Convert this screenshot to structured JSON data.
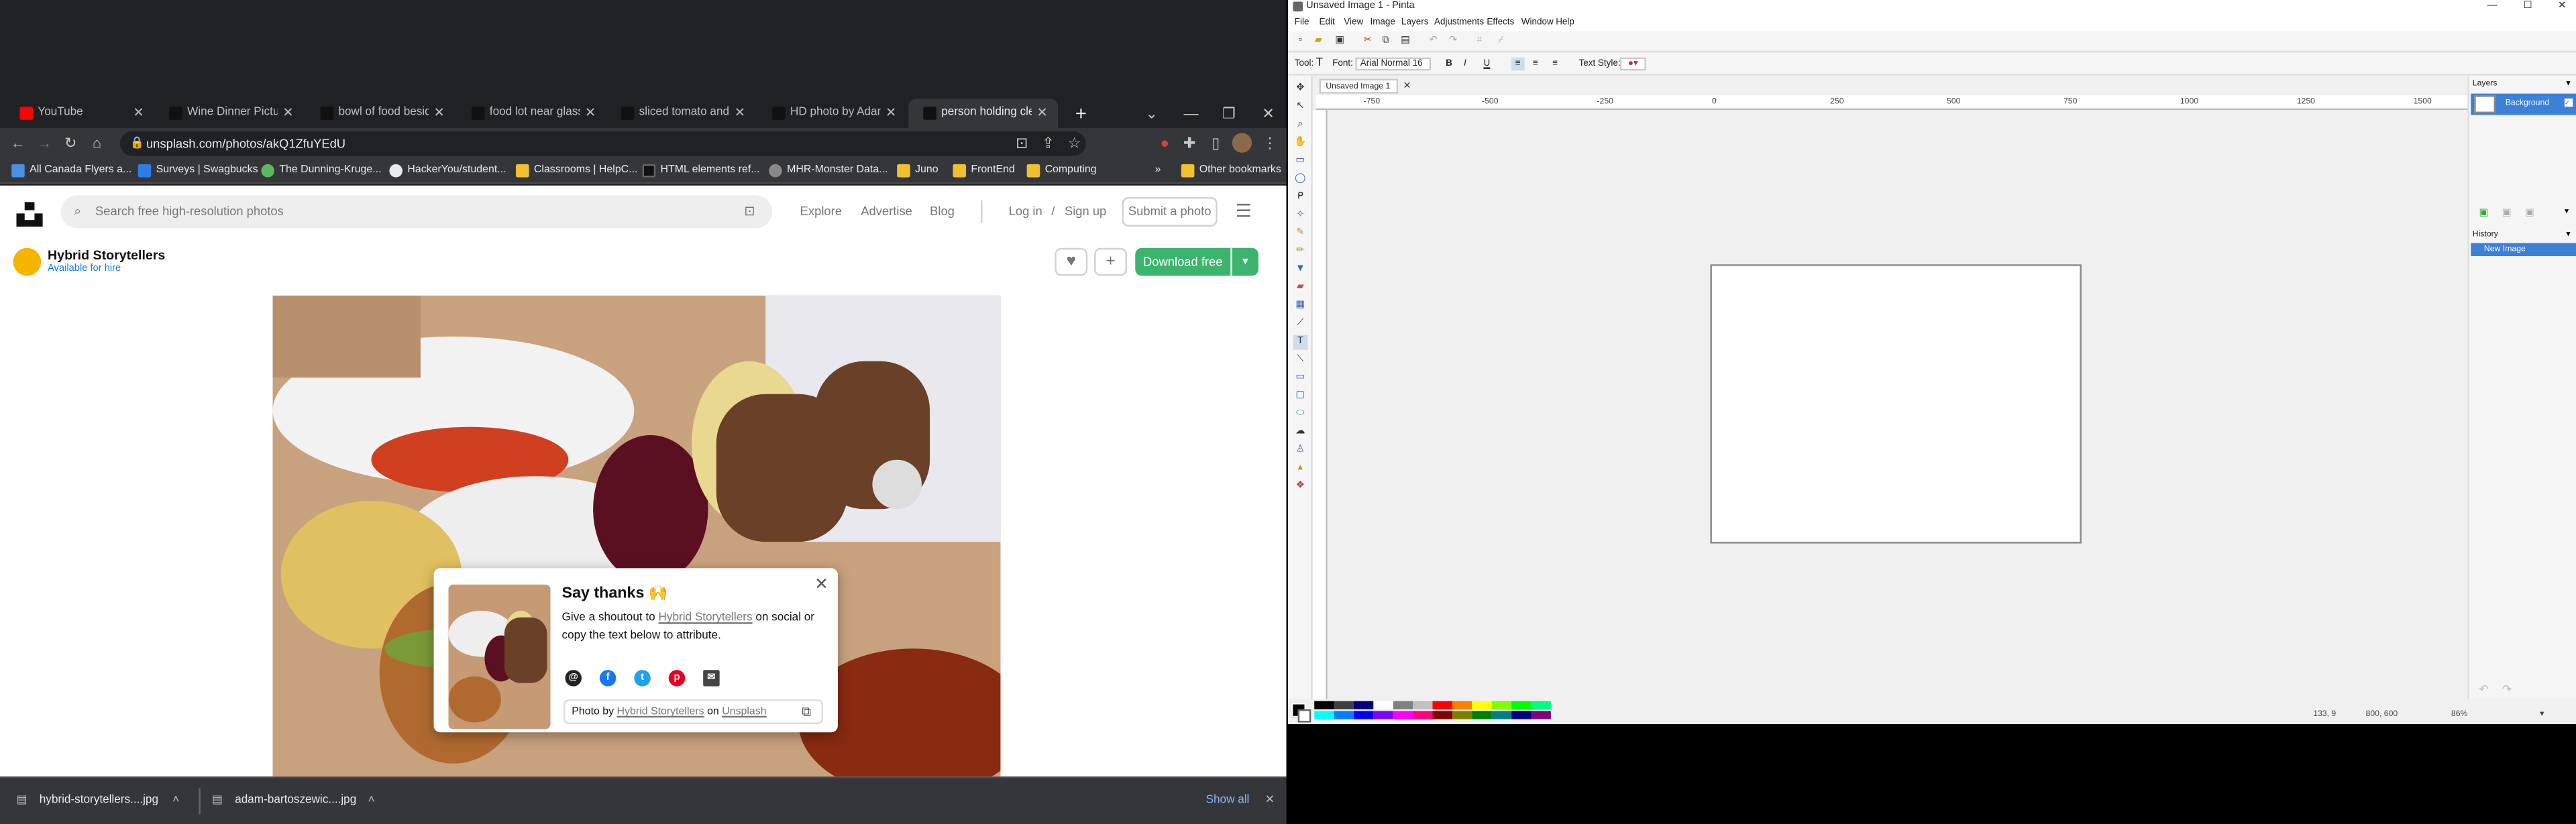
{
  "browser": {
    "tabs": [
      {
        "label": "YouTube",
        "color": "#ff0000"
      },
      {
        "label": "Wine Dinner Pictures",
        "color": "#111111"
      },
      {
        "label": "bowl of food beside",
        "color": "#111111"
      },
      {
        "label": "food lot near glasses",
        "color": "#111111"
      },
      {
        "label": "sliced tomato and cu",
        "color": "#111111"
      },
      {
        "label": "HD photo by Adam B",
        "color": "#111111"
      },
      {
        "label": "person holding clear",
        "color": "#111111"
      }
    ],
    "new_tab_label": "+",
    "url": "unsplash.com/photos/akQ1ZfuYEdU",
    "bookmarks": [
      {
        "label": "All Canada Flyers a...",
        "color": "#4a90e2"
      },
      {
        "label": "Surveys | Swagbucks",
        "color": "#2b7de9"
      },
      {
        "label": "The Dunning-Kruge...",
        "color": "#5cb85c"
      },
      {
        "label": "HackerYou/student...",
        "color": "#e8eaed"
      },
      {
        "label": "Classrooms | HelpC...",
        "color": "#f0c030"
      },
      {
        "label": "HTML elements ref...",
        "color": "#111111"
      },
      {
        "label": "MHR-Monster Data...",
        "color": "#888888"
      },
      {
        "label": "Juno",
        "color": "#f0c030"
      },
      {
        "label": "FrontEnd",
        "color": "#f0c030"
      },
      {
        "label": "Computing",
        "color": "#f0c030"
      }
    ],
    "bookmarks_more": "»",
    "other_bookmarks": "Other bookmarks",
    "downloads": [
      {
        "label": "hybrid-storytellers....jpg"
      },
      {
        "label": "adam-bartoszewic....jpg"
      }
    ],
    "show_all": "Show all"
  },
  "unsplash": {
    "search_placeholder": "Search free high-resolution photos",
    "nav": [
      "Explore",
      "Advertise",
      "Blog"
    ],
    "login": "Log in",
    "slash": "/",
    "signup": "Sign up",
    "submit": "Submit a photo",
    "author_name": "Hybrid Storytellers",
    "author_status": "Available for hire",
    "download": "Download free",
    "popup": {
      "title": "Say thanks 🙌",
      "body_pre": "Give a shoutout to",
      "body_link": "Hybrid Storytellers",
      "body_post": "on social or copy the text below to attribute.",
      "credit_pre": "Photo by",
      "credit_author": "Hybrid Storytellers",
      "credit_mid": "on",
      "credit_site": "Unsplash"
    }
  },
  "pinta": {
    "title": "Unsaved Image 1 - Pinta",
    "menu": [
      "File",
      "Edit",
      "View",
      "Image",
      "Layers",
      "Adjustments",
      "Effects",
      "Window",
      "Help"
    ],
    "tool_label": "Tool:",
    "font_label": "Font:",
    "font_value": "Arial Normal",
    "font_size": "16",
    "text_style_label": "Text Style:",
    "doc_tab": "Unsaved Image 1",
    "ruler_labels": [
      "-750",
      "-500",
      "-250",
      "0",
      "250",
      "500",
      "750",
      "1000",
      "1250",
      "1500"
    ],
    "layers_label": "Layers",
    "layer_name": "Background",
    "history_label": "History",
    "history_item": "New Image",
    "status_cursor": "133, 9",
    "status_size": "800, 600",
    "zoom": "86%",
    "palette": [
      "#000000",
      "#404040",
      "#000080",
      "#ffffff",
      "#808080",
      "#c0c0c0",
      "#ff0000",
      "#ff8000",
      "#ffff00",
      "#80ff00",
      "#00ff00",
      "#00ff80",
      "#00ffff",
      "#0080ff",
      "#0000ff",
      "#8000ff",
      "#ff00ff",
      "#ff0080",
      "#800000",
      "#808000",
      "#008000",
      "#008080",
      "#000080",
      "#800080"
    ]
  }
}
